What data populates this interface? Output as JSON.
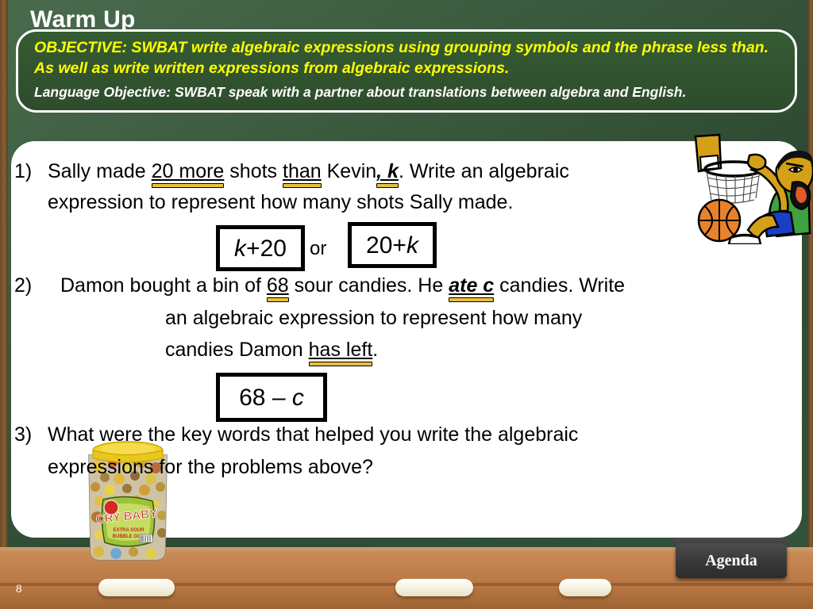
{
  "slide": {
    "title": "Warm Up",
    "page_number": "8",
    "colors": {
      "board_green": "#2e4a32",
      "objective_yellow": "#ffff00",
      "ledge_wood": "#c07f4c",
      "highlight_gold": "#e8c13c",
      "panel_white": "#ffffff"
    }
  },
  "objective": {
    "main_text": "OBJECTIVE: SWBAT  write algebraic expressions using grouping symbols and the phrase less than. As well as write written expressions from algebraic expressions.",
    "language_text": "Language Objective: SWBAT speak with a partner about translations between algebra and English."
  },
  "problems": {
    "p1": {
      "number": "1)",
      "line1_a": "Sally made ",
      "line1_key1": "20 more",
      "line1_b": " shots ",
      "line1_key2": "than",
      "line1_c": " Kevin",
      "line1_key3": ", k",
      "line1_d": ".  Write an algebraic",
      "line2": "expression to represent how many shots Sally made.",
      "answer_1": "k+20",
      "or_label": "or",
      "answer_2": "20+k"
    },
    "p2": {
      "number": "2)",
      "line1_a": "Damon bought a bin of ",
      "line1_key1": "68",
      "line1_b": " sour candies.  He ",
      "line1_key2": "ate c",
      "line1_c": " candies.  Write",
      "line2": "an algebraic expression to represent how many",
      "line3_a": "candies Damon ",
      "line3_key": "has left",
      "line3_b": ".",
      "answer": "68 – c"
    },
    "p3": {
      "number": "3)",
      "line1": "What were the key words that helped you write the algebraic",
      "line2": "expressions for the problems above?"
    }
  },
  "footer": {
    "agenda_label": "Agenda"
  },
  "images": {
    "candy_jar_brand": "CRY BABY",
    "candy_jar_sub": "EXTRA SOUR BUBBLE GUM",
    "basketball_clipart": "basketball-player-dunking"
  }
}
